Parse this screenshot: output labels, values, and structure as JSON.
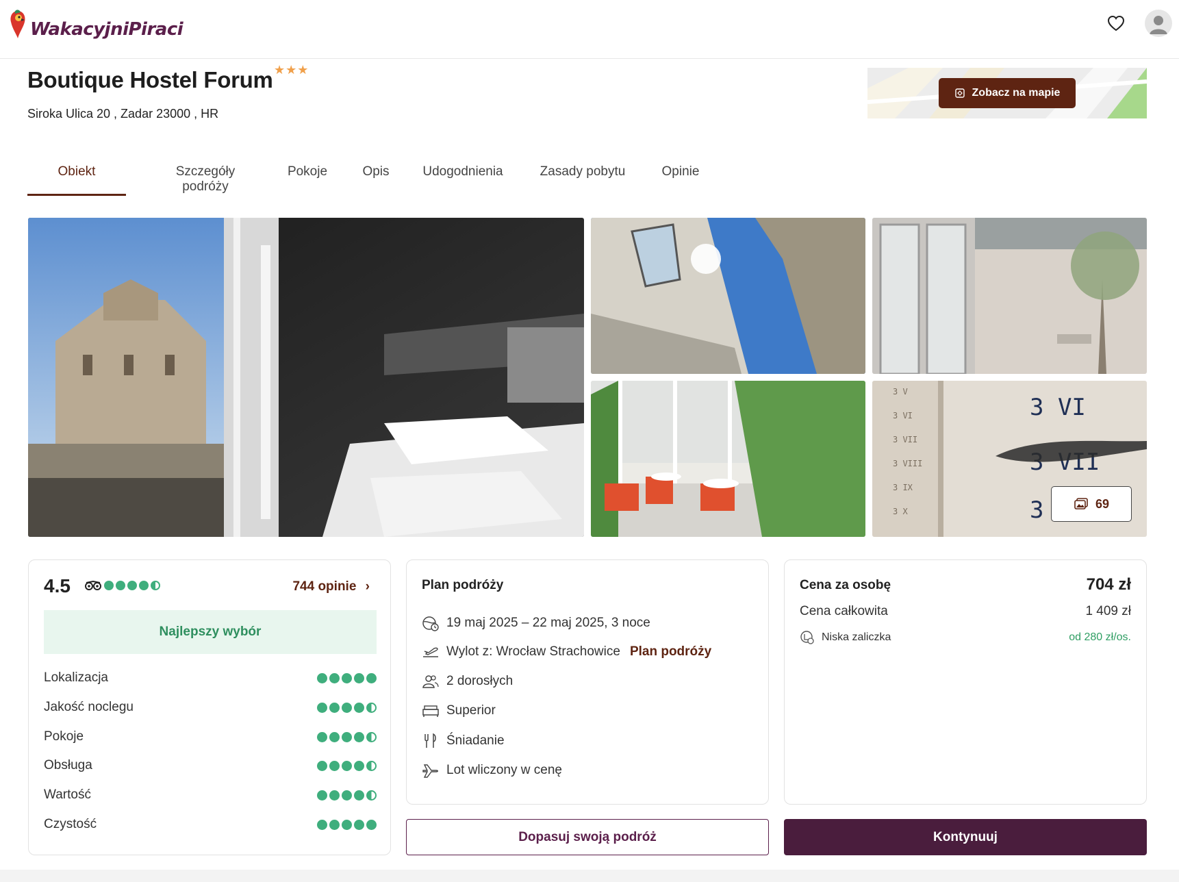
{
  "brand": {
    "name": "WakacyjniPiraci",
    "color": "#5b1f4b"
  },
  "header": {
    "favorites_icon": "heart-icon",
    "account_icon": "user-avatar-icon"
  },
  "hotel": {
    "name": "Boutique Hostel Forum",
    "stars": "★★★",
    "address": "Siroka Ulica 20 , Zadar 23000 , HR"
  },
  "map": {
    "button_label": "Zobacz na mapie"
  },
  "tabs": [
    {
      "label": "Obiekt",
      "active": true
    },
    {
      "label": "Szczegóły podróży"
    },
    {
      "label": "Pokoje"
    },
    {
      "label": "Opis"
    },
    {
      "label": "Udogodnienia"
    },
    {
      "label": "Zasady pobytu"
    },
    {
      "label": "Opinie"
    }
  ],
  "gallery": {
    "photo_count": "69"
  },
  "rating": {
    "score": "4.5",
    "reviews_label": "744 opinie",
    "badge": "Najlepszy wybór",
    "overall_dots": 4.5,
    "criteria": [
      {
        "label": "Lokalizacja",
        "dots": 5
      },
      {
        "label": "Jakość noclegu",
        "dots": 4.5
      },
      {
        "label": "Pokoje",
        "dots": 4.5
      },
      {
        "label": "Obsługa",
        "dots": 4.5
      },
      {
        "label": "Wartość",
        "dots": 4.5
      },
      {
        "label": "Czystość",
        "dots": 5
      }
    ]
  },
  "plan": {
    "title": "Plan podróży",
    "dates": "19 maj 2025 – 22 maj 2025, 3 noce",
    "departure": "Wylot z: Wrocław Strachowice",
    "departure_link": "Plan podróży",
    "guests": "2 dorosłych",
    "room": "Superior",
    "board": "Śniadanie",
    "flight": "Lot wliczony w cenę"
  },
  "price": {
    "per_person_label": "Cena za osobę",
    "per_person_value": "704 zł",
    "total_label": "Cena całkowita",
    "total_value": "1 409 zł",
    "deposit_label": "Niska zaliczka",
    "deposit_value": "od 280 zł/os."
  },
  "actions": {
    "adjust_label": "Dopasuj swoją podróż",
    "continue_label": "Kontynuuj"
  }
}
